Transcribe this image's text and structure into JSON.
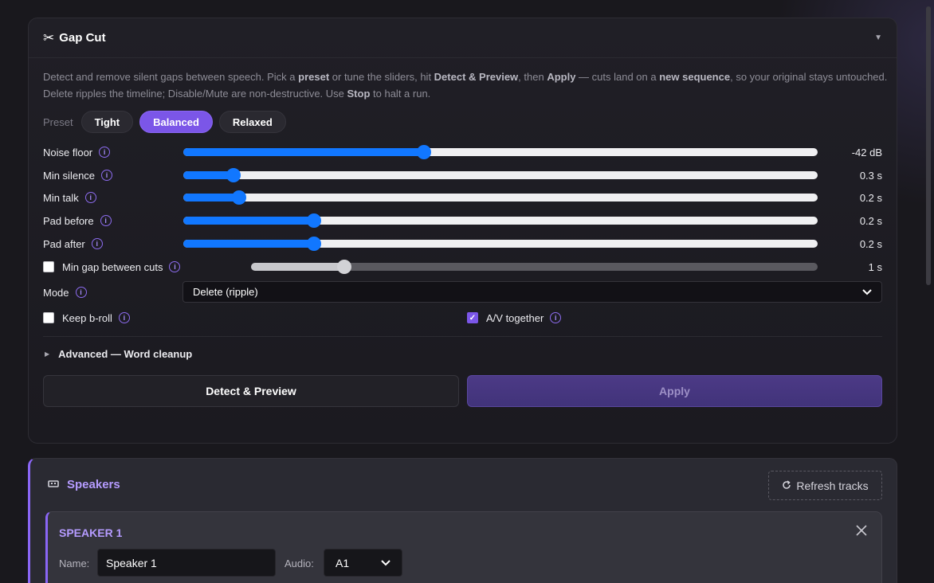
{
  "gap_cut": {
    "title": "Gap Cut",
    "toggle_icon": "▼",
    "description": [
      {
        "text": "Detect and remove silent gaps between speech. Pick a ",
        "bold": false
      },
      {
        "text": "preset",
        "bold": true
      },
      {
        "text": " or tune the sliders, hit ",
        "bold": false
      },
      {
        "text": "Detect & Preview",
        "bold": true
      },
      {
        "text": ", then ",
        "bold": false
      },
      {
        "text": "Apply",
        "bold": true
      },
      {
        "text": " — cuts land on a ",
        "bold": false
      },
      {
        "text": "new sequence",
        "bold": true
      },
      {
        "text": ", so your original stays untouched. Delete ripples the timeline; Disable/Mute are non-destructive. Use ",
        "bold": false
      },
      {
        "text": "Stop",
        "bold": true
      },
      {
        "text": " to halt a run.",
        "bold": false
      }
    ],
    "preset_label": "Preset",
    "presets": [
      {
        "label": "Tight",
        "active": false
      },
      {
        "label": "Balanced",
        "active": true
      },
      {
        "label": "Relaxed",
        "active": false
      }
    ],
    "sliders": [
      {
        "label": "Noise floor",
        "value": "-42 dB",
        "fraction": 0.38
      },
      {
        "label": "Min silence",
        "value": "0.3 s",
        "fraction": 0.079
      },
      {
        "label": "Min talk",
        "value": "0.2 s",
        "fraction": 0.088
      },
      {
        "label": "Pad before",
        "value": "0.2 s",
        "fraction": 0.206
      },
      {
        "label": "Pad after",
        "value": "0.2 s",
        "fraction": 0.206
      }
    ],
    "min_gap": {
      "label": "Min gap between cuts",
      "value": "1 s",
      "fraction": 0.165,
      "checked": false
    },
    "mode": {
      "label": "Mode",
      "selected": "Delete (ripple)"
    },
    "keep_broll": {
      "label": "Keep b-roll",
      "checked": false
    },
    "av_together": {
      "label": "A/V together",
      "checked": true
    },
    "advanced_label": "Advanced — Word cleanup",
    "detect_label": "Detect & Preview",
    "apply_label": "Apply",
    "info_glyph": "i"
  },
  "speakers": {
    "title": "Speakers",
    "refresh_label": "Refresh tracks",
    "cards": [
      {
        "title": "SPEAKER 1",
        "name_label": "Name:",
        "name_value": "Speaker 1",
        "audio_label": "Audio:",
        "audio_value": "A1"
      }
    ]
  },
  "colors": {
    "accent": "#7b56e8",
    "slider_blue": "#1177ff",
    "speaker_title": "#b59bff"
  }
}
